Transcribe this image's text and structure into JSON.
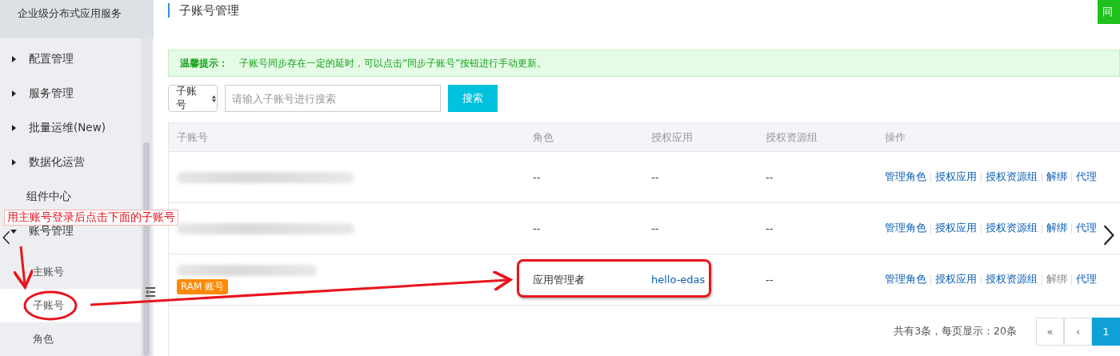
{
  "sidebar": {
    "title": "企业级分布式应用服务",
    "items": [
      {
        "kind": "group",
        "label": "配置管理",
        "expanded": false
      },
      {
        "kind": "group",
        "label": "服务管理",
        "expanded": false
      },
      {
        "kind": "group",
        "label": "批量运维(New)",
        "expanded": false
      },
      {
        "kind": "group",
        "label": "数据化运营",
        "expanded": false
      },
      {
        "kind": "link",
        "label": "组件中心"
      },
      {
        "kind": "group",
        "label": "账号管理",
        "expanded": true,
        "children": [
          {
            "label": "主账号",
            "selected": false
          },
          {
            "label": "子账号",
            "selected": true
          },
          {
            "label": "角色",
            "selected": false
          }
        ]
      }
    ]
  },
  "page": {
    "title": "子账号管理",
    "top_button": "同"
  },
  "alert": {
    "title": "温馨提示：",
    "text": "子账号同步存在一定的延时，可以点击“同步子账号”按钮进行手动更新。"
  },
  "search": {
    "filter": "子账号",
    "placeholder": "请输入子账号进行搜索",
    "button": "搜索"
  },
  "table": {
    "columns": [
      "子账号",
      "角色",
      "授权应用",
      "授权资源组",
      "操作"
    ],
    "rows": [
      {
        "role": "--",
        "app": {
          "text": "--",
          "link": false
        },
        "resource_group": "--",
        "highlighted": false,
        "actions": [
          {
            "label": "管理角色",
            "disabled": false
          },
          {
            "label": "授权应用",
            "disabled": false
          },
          {
            "label": "授权资源组",
            "disabled": false
          },
          {
            "label": "解绑",
            "disabled": false
          },
          {
            "label": "代理",
            "disabled": false
          }
        ]
      },
      {
        "role": "--",
        "app": {
          "text": "--",
          "link": false
        },
        "resource_group": "--",
        "highlighted": false,
        "actions": [
          {
            "label": "管理角色",
            "disabled": false
          },
          {
            "label": "授权应用",
            "disabled": false
          },
          {
            "label": "授权资源组",
            "disabled": false
          },
          {
            "label": "解绑",
            "disabled": false
          },
          {
            "label": "代理",
            "disabled": false
          }
        ]
      },
      {
        "badge": "RAM 账号",
        "role": "应用管理者",
        "app": {
          "text": "hello-edas",
          "link": true
        },
        "resource_group": "--",
        "highlighted": true,
        "actions": [
          {
            "label": "管理角色",
            "disabled": false
          },
          {
            "label": "授权应用",
            "disabled": false
          },
          {
            "label": "授权资源组",
            "disabled": false
          },
          {
            "label": "解绑",
            "disabled": true
          },
          {
            "label": "代理",
            "disabled": false
          }
        ]
      }
    ]
  },
  "pagination": {
    "summary": "共有3条，每页显示：20条",
    "pages": [
      {
        "label": "«",
        "selected": false
      },
      {
        "label": "‹",
        "selected": false
      },
      {
        "label": "1",
        "selected": true
      }
    ]
  },
  "annotation": {
    "text": "用主账号登录后点击下面的子账号"
  }
}
